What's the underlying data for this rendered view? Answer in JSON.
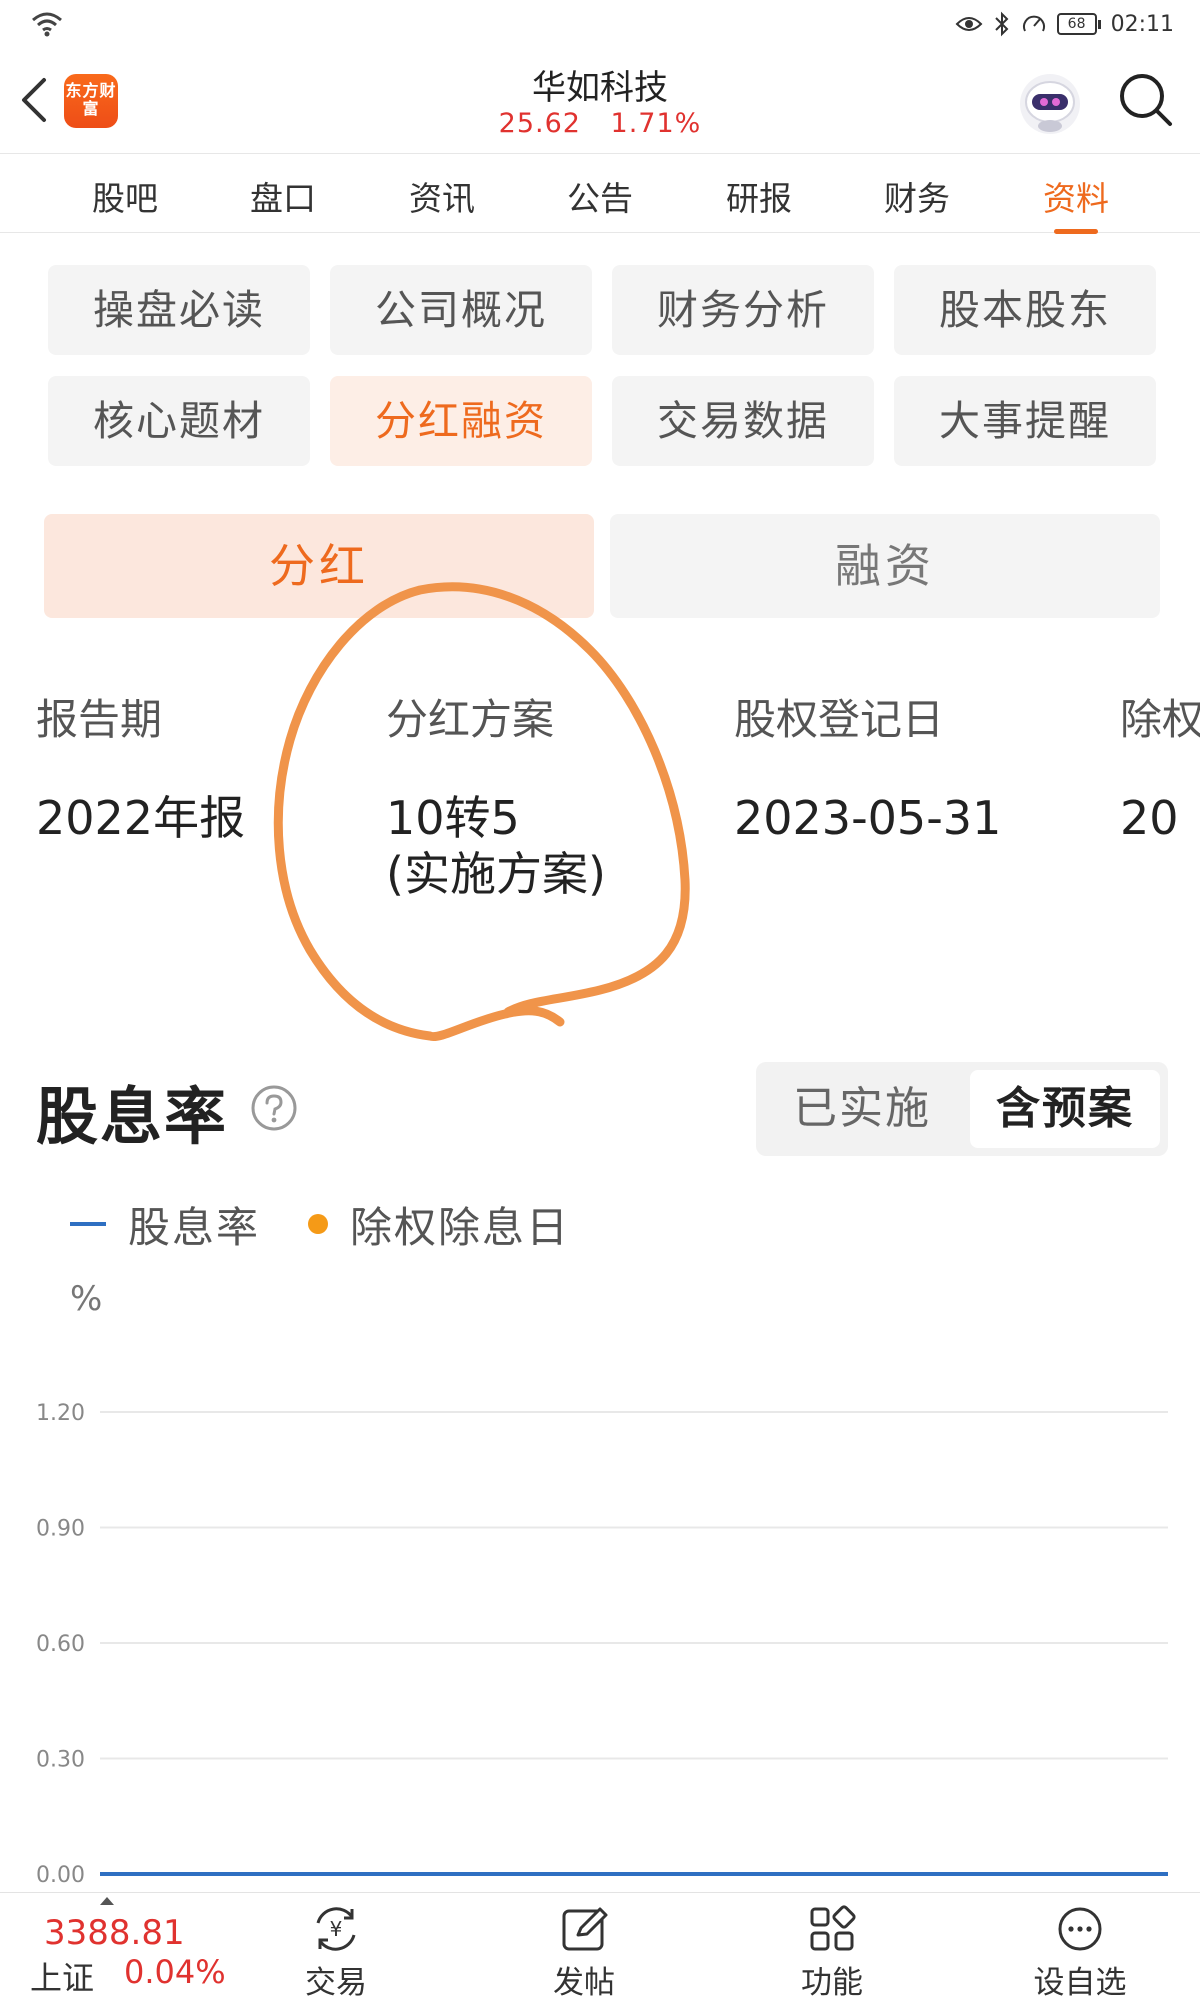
{
  "status_bar": {
    "time": "02:11",
    "battery": "68"
  },
  "header": {
    "logo_text": "东方财富",
    "stock_name": "华如科技",
    "price": "25.62",
    "change_pct": "1.71%"
  },
  "tabs": [
    {
      "label": "股吧"
    },
    {
      "label": "盘口"
    },
    {
      "label": "资讯"
    },
    {
      "label": "公告"
    },
    {
      "label": "研报"
    },
    {
      "label": "财务"
    },
    {
      "label": "资料",
      "active": true
    }
  ],
  "grid_buttons": [
    {
      "label": "操盘必读"
    },
    {
      "label": "公司概况"
    },
    {
      "label": "财务分析"
    },
    {
      "label": "股本股东"
    },
    {
      "label": "核心题材"
    },
    {
      "label": "分红融资",
      "active": true
    },
    {
      "label": "交易数据"
    },
    {
      "label": "大事提醒"
    }
  ],
  "segment": {
    "left": "分红",
    "right": "融资",
    "active": "left"
  },
  "dividend_table": {
    "headers": [
      "报告期",
      "分红方案",
      "股权登记日",
      "除权"
    ],
    "row": {
      "report_period": "2022年报",
      "plan_line1": "10转5",
      "plan_line2": "(实施方案)",
      "record_date": "2023-05-31",
      "ex_date_partial": "20"
    }
  },
  "dividend_yield": {
    "title": "股息率",
    "toggle_off": "已实施",
    "toggle_on": "含预案",
    "legend_series": "股息率",
    "legend_marker": "除权除息日",
    "unit": "%"
  },
  "chart_data": {
    "type": "line",
    "ylabel": "%",
    "ylim": [
      0,
      1.2
    ],
    "yticks": [
      "1.20",
      "0.90",
      "0.60",
      "0.30",
      "0.00"
    ],
    "series": [
      {
        "name": "股息率",
        "values": [
          0,
          0
        ]
      },
      {
        "name": "除权除息日",
        "values": []
      }
    ],
    "grid": true
  },
  "bottom_bar": {
    "index_value": "3388.81",
    "index_name": "上证",
    "index_change": "0.04%",
    "items": [
      {
        "label": "交易",
        "icon": "trade-yuan-icon"
      },
      {
        "label": "发帖",
        "icon": "post-edit-icon"
      },
      {
        "label": "功能",
        "icon": "grid-apps-icon"
      },
      {
        "label": "设自选",
        "icon": "more-circle-icon"
      }
    ]
  },
  "colors": {
    "accent": "#ee6a1e",
    "price_up": "#e0322f",
    "series_blue": "#2e6fc2",
    "marker_orange": "#f59a17",
    "annotation": "#f0944a"
  }
}
